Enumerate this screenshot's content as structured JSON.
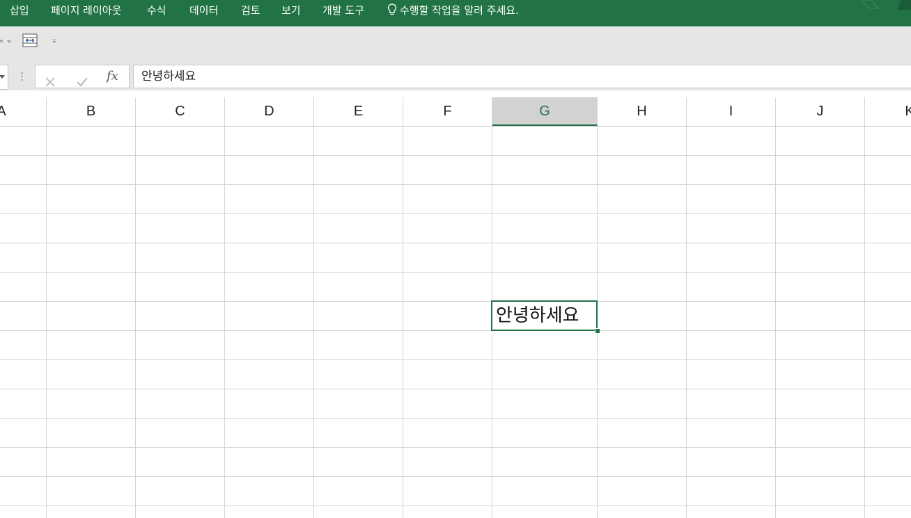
{
  "ribbon": {
    "tabs": [
      "삽입",
      "페이지 레이아웃",
      "수식",
      "데이터",
      "검토",
      "보기",
      "개발 도구"
    ],
    "tell_me": "수행할 작업을 알려 주세요."
  },
  "formula_bar": {
    "fx_label": "fx",
    "value": "안녕하세요"
  },
  "columns": [
    "A",
    "B",
    "C",
    "D",
    "E",
    "F",
    "G",
    "H",
    "I",
    "J",
    "K"
  ],
  "selected_column": "G",
  "active_cell": {
    "column": "G",
    "value": "안녕하세요"
  },
  "colors": {
    "accent": "#217346",
    "toolbar": "#e6e6e6",
    "gridline": "#d4d4d4"
  }
}
